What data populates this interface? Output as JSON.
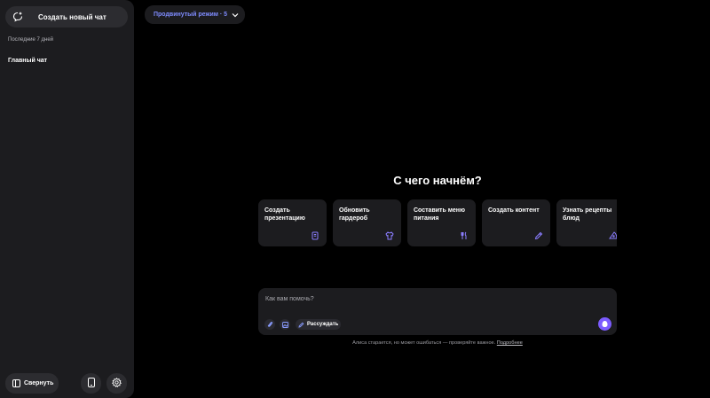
{
  "sidebar": {
    "new_chat_label": "Создать новый чат",
    "section_title": "Последние 7 дней",
    "chats": [
      "Главный чат"
    ],
    "collapse_label": "Свернуть"
  },
  "mode": {
    "label": "Продвинутый режим · 5"
  },
  "main": {
    "heading": "С чего начнём?",
    "cards": [
      {
        "label": "Создать презентацию",
        "icon": "presentation-icon"
      },
      {
        "label": "Обновить гардероб",
        "icon": "shirt-icon"
      },
      {
        "label": "Составить меню питания",
        "icon": "fork-knife-icon"
      },
      {
        "label": "Создать контент",
        "icon": "pencil-icon"
      },
      {
        "label": "Узнать рецепты блюд",
        "icon": "pizza-icon"
      }
    ]
  },
  "input": {
    "placeholder": "Как вам помочь?",
    "reason_label": "Рассуждать"
  },
  "disclaimer": {
    "text": "Алиса старается, но может ошибаться — проверяйте важное.",
    "link": "Подробнее"
  },
  "colors": {
    "accent": "#7f8cff",
    "send_button": "#7c5cff",
    "panel": "#1c1c1f"
  }
}
